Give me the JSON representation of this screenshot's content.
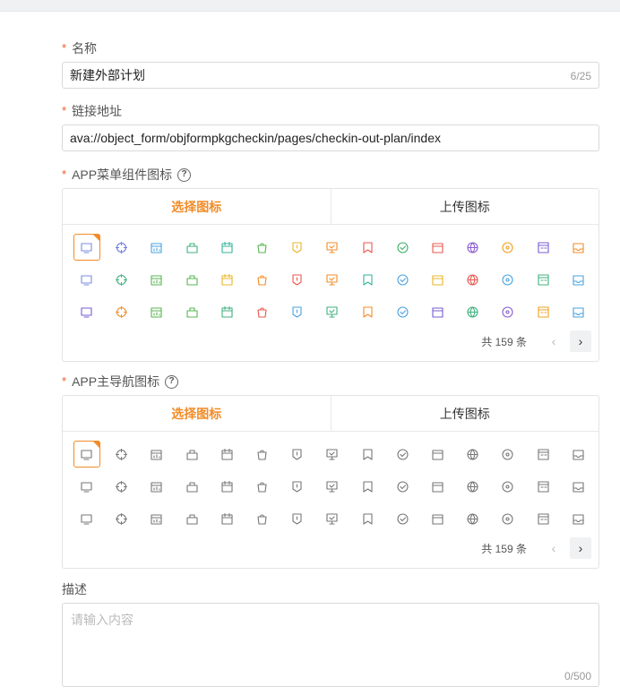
{
  "form": {
    "name": {
      "label": "名称",
      "value": "新建外部计划",
      "counter": "6/25"
    },
    "link": {
      "label": "链接地址",
      "value": "ava://object_form/objformpkgcheckin/pages/checkin-out-plan/index"
    },
    "app_menu_icon": {
      "label": "APP菜单组件图标",
      "help": "?",
      "tabs": [
        "选择图标",
        "上传图标"
      ],
      "total": "共 159 条",
      "prev": "‹",
      "next": "›"
    },
    "app_nav_icon": {
      "label": "APP主导航图标",
      "help": "?",
      "tabs": [
        "选择图标",
        "上传图标"
      ],
      "total": "共 159 条",
      "prev": "‹",
      "next": "›"
    },
    "description": {
      "label": "描述",
      "placeholder": "请输入内容",
      "counter": "0/500"
    },
    "required_mark": "*"
  },
  "icons": [
    "monitor-icon",
    "target-icon",
    "chart-calendar-icon",
    "briefcase-icon",
    "calendar-icon",
    "shopping-bag-icon",
    "shield-flag-icon",
    "presentation-icon",
    "bookmark-icon",
    "check-circle-icon",
    "card-icon",
    "globe-icon",
    "disc-icon",
    "calendar-box-icon",
    "inbox-icon",
    "archive-icon",
    "pencil-icon",
    "clipboard-check-icon",
    "image-chart-icon",
    "signpost-icon",
    "gas-pump-icon",
    "buildings-icon",
    "radar-icon",
    "network-icon",
    "window-icon",
    "building-icon",
    "clock-icon",
    "home-icon",
    "yen-note-icon",
    "store-icon",
    "apps-icon",
    "shop-icon",
    "clipboard-list-icon",
    "save-icon",
    "shield-icon",
    "flower-icon",
    "cloud-upload-icon",
    "document-list-icon",
    "grid-box-icon",
    "question-bubble-icon",
    "code-box-icon",
    "bolt-circle-icon",
    "bulb-icon",
    "badge-icon",
    "storefront-icon"
  ],
  "colors": {
    "accent": "#f28c28",
    "menu_icons": [
      "#7b8cde",
      "#6c7ae0",
      "#4aa3df",
      "#3fb27f",
      "#36b39b",
      "#5ab552",
      "#e9b52a",
      "#f28c28",
      "#e8584f",
      "#3ab26a",
      "#e8584f",
      "#8a5cd1",
      "#f0a020",
      "#7a5cd1",
      "#f28c28",
      "#7a8cde",
      "#3fb27f",
      "#5ab552",
      "#5ab552",
      "#e9b52a",
      "#f28c28",
      "#e8584f",
      "#f28c28",
      "#36b39b",
      "#4aa3df",
      "#e9b52a",
      "#e8584f",
      "#4aa3df",
      "#3fb27f",
      "#4aa3df",
      "#7a5cd1",
      "#f28c28",
      "#5ab552",
      "#5ab552",
      "#3fb27f",
      "#e8584f",
      "#4aa3df",
      "#3fb27f",
      "#f28c28",
      "#4aa3df",
      "#7a5cd1",
      "#3fb27f",
      "#8a5cd1",
      "#f0a020",
      "#4aa3df"
    ],
    "nav_icon": "#777777"
  }
}
